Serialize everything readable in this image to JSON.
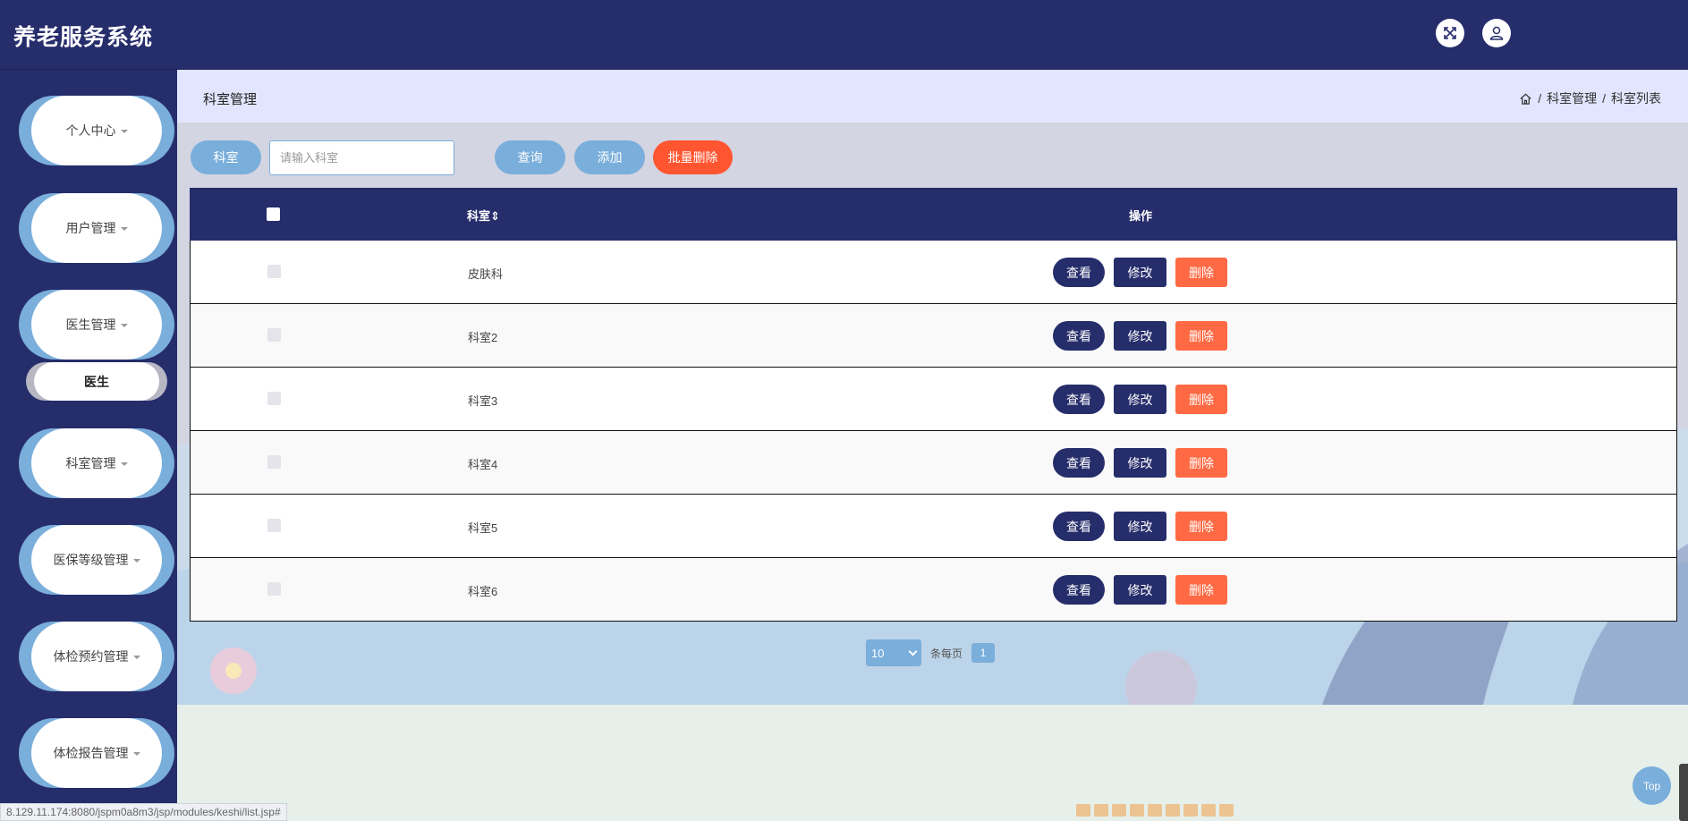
{
  "header": {
    "title": "养老服务系统"
  },
  "sidebar": {
    "items": [
      {
        "label": "个人中心"
      },
      {
        "label": "用户管理"
      },
      {
        "label": "医生管理"
      },
      {
        "label": "科室管理"
      },
      {
        "label": "医保等级管理"
      },
      {
        "label": "体检预约管理"
      },
      {
        "label": "体检报告管理"
      }
    ],
    "submenu": {
      "label": "医生"
    }
  },
  "page": {
    "title": "科室管理",
    "breadcrumb": [
      "科室管理",
      "科室列表"
    ],
    "breadcrumb_sep": "/"
  },
  "search": {
    "label": "科室",
    "placeholder": "请输入科室",
    "query_button": "查询",
    "add_button": "添加",
    "batch_delete_button": "批量删除"
  },
  "table": {
    "columns": {
      "name": "科室⇕",
      "ops": "操作"
    },
    "rows": [
      {
        "name": "皮肤科"
      },
      {
        "name": "科室2"
      },
      {
        "name": "科室3"
      },
      {
        "name": "科室4"
      },
      {
        "name": "科室5"
      },
      {
        "name": "科室6"
      }
    ],
    "actions": {
      "view": "查看",
      "edit": "修改",
      "delete": "删除"
    }
  },
  "pagination": {
    "page_size": "10",
    "per_page_label": "条每页",
    "current_page": "1"
  },
  "top_button": "Top",
  "status_url": "8.129.11.174:8080/jspm0a8m3/jsp/modules/keshi/list.jsp#",
  "colors": {
    "primary": "#262d6b",
    "accent": "#7aaedb",
    "danger": "#ff5530",
    "crumb_bg": "#e1e5fd"
  }
}
